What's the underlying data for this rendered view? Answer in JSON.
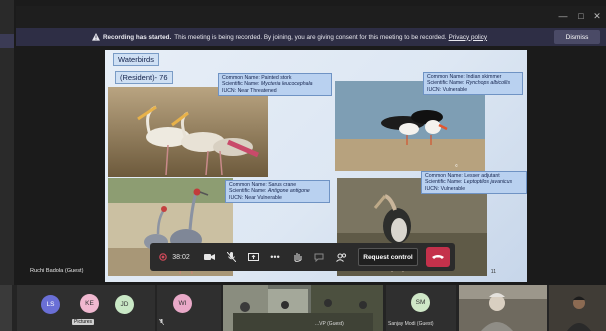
{
  "banner": {
    "bold": "Recording has started.",
    "message": "This meeting is being recorded. By joining, you are giving consent for this meeting to be recorded.",
    "policy_link": "Privacy policy",
    "dismiss": "Dismiss"
  },
  "slide": {
    "tag_title": "Waterbirds",
    "tag_resident": "(Resident)- 76",
    "birds": [
      {
        "line1": "Common Name: Painted stork",
        "line2_prefix": "Scientific Name: ",
        "sci": "Mycteria leucocephala",
        "line3": "IUCN: Near Threatened"
      },
      {
        "line1": "Common Name: Indian skimmer",
        "line2_prefix": "Scientific Name: ",
        "sci": "Rynchops albicollis",
        "line3": "IUCN: Vulnerable"
      },
      {
        "line1": "Common Name: Sarus crane",
        "line2_prefix": "Scientific Name: ",
        "sci": "Antigone antigone",
        "line3": "IUCN: Near Vulnerable"
      },
      {
        "line1": "Common Name: Lesser adjutant",
        "line2_prefix": "Scientific Name: ",
        "sci": "Leptoptilos javanicus",
        "line3": "IUCN: Vulnerable"
      }
    ],
    "page_number": "11"
  },
  "controls": {
    "timer": "38:02",
    "request_control": "Request control"
  },
  "presenter": {
    "name": "Ruchi Badola (Guest)"
  },
  "participants": [
    {
      "initials": "LS",
      "color": "#6a6fd6"
    },
    {
      "initials": "KE",
      "color": "#f0b8d0",
      "label": "Pictures"
    },
    {
      "initials": "JD",
      "color": "#c9e8c6"
    },
    {
      "initials": "WI",
      "color": "#e9a9c8"
    },
    {
      "initials": "SM",
      "color": "#cfe7c7",
      "name": "Sanjay Modi (Guest)"
    }
  ],
  "video_tile_name": "...VP (Guest)",
  "colors": {
    "accent": "#4a4a66",
    "hangup": "#c4314b",
    "banner": "#2e2e45"
  }
}
